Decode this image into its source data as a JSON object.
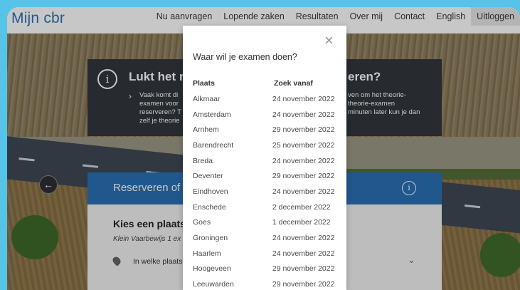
{
  "header": {
    "logo": "Mijn cbr",
    "nav": [
      "Nu aanvragen",
      "Lopende zaken",
      "Resultaten",
      "Over mij",
      "Contact",
      "English",
      "Uitloggen"
    ]
  },
  "notice": {
    "title_left": "Lukt het nie",
    "title_right": "eren?",
    "text_left": [
      "Vaak komt di",
      "examen voor",
      "reserveren? T",
      "zelf je theorie"
    ],
    "text_right": [
      "ven om het theorie-",
      "theorie-examen",
      "minuten later kun je dan"
    ]
  },
  "panel": {
    "title": "Reserveren of",
    "heading": "Kies een plaats e",
    "subtitle": "Klein Vaarbewijs 1 ex",
    "location_prompt": "In welke plaats"
  },
  "modal": {
    "title": "Waar wil je examen doen?",
    "col_place": "Plaats",
    "col_date": "Zoek vanaf",
    "rows": [
      {
        "place": "Alkmaar",
        "date": "24 november 2022"
      },
      {
        "place": "Amsterdam",
        "date": "24 november 2022"
      },
      {
        "place": "Arnhem",
        "date": "29 november 2022"
      },
      {
        "place": "Barendrecht",
        "date": "25 november 2022"
      },
      {
        "place": "Breda",
        "date": "24 november 2022"
      },
      {
        "place": "Deventer",
        "date": "29 november 2022"
      },
      {
        "place": "Eindhoven",
        "date": "24 november 2022"
      },
      {
        "place": "Enschede",
        "date": "2 december 2022"
      },
      {
        "place": "Goes",
        "date": "1 december 2022"
      },
      {
        "place": "Groningen",
        "date": "24 november 2022"
      },
      {
        "place": "Haarlem",
        "date": "24 november 2022"
      },
      {
        "place": "Hoogeveen",
        "date": "29 november 2022"
      },
      {
        "place": "Leeuwarden",
        "date": "29 november 2022"
      }
    ]
  },
  "colors": {
    "brand_blue": "#2a71b7",
    "frame_bg": "#55c4e8",
    "notice_bg": "#33373c"
  },
  "icons": [
    "close-icon",
    "info-icon",
    "chevron-right-icon",
    "arrow-left-icon",
    "location-pin-icon",
    "chevron-down-icon"
  ]
}
